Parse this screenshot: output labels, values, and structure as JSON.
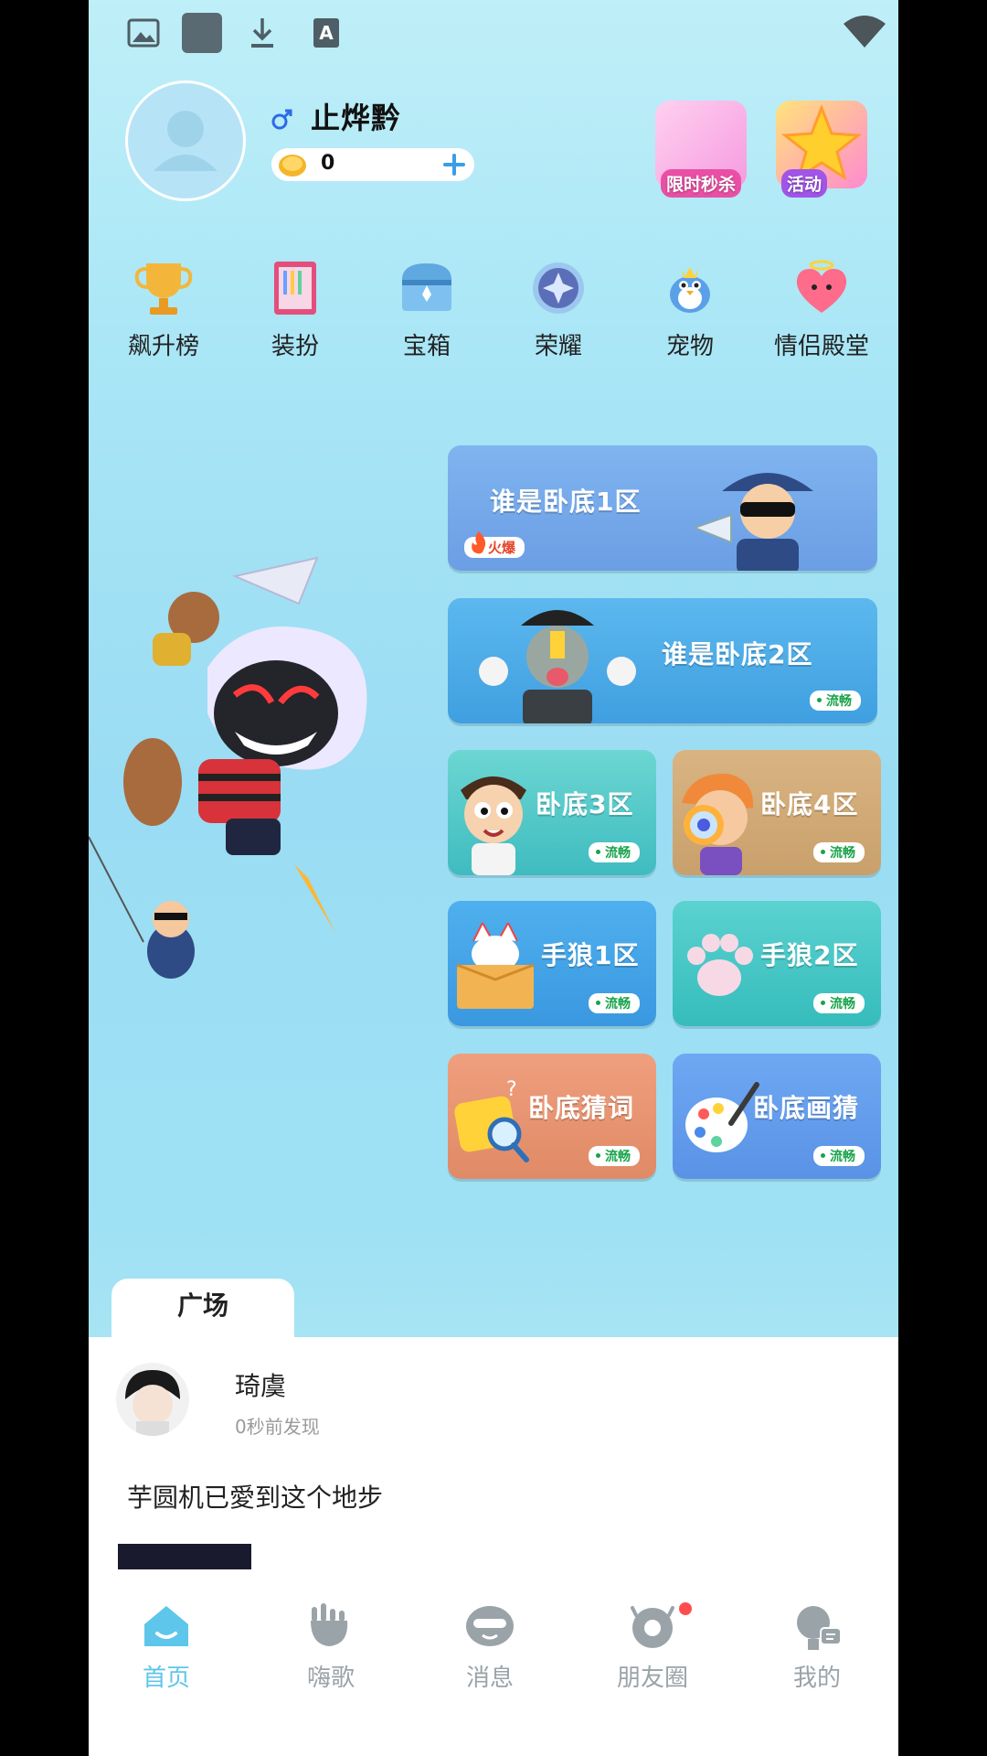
{
  "profile": {
    "username": "止烨黔",
    "coins": "0"
  },
  "promos": [
    {
      "label": "限时秒杀",
      "icon": "gift-box-icon",
      "color": "#e94fa5"
    },
    {
      "label": "活动",
      "icon": "star-icon",
      "color": "#a154e8"
    }
  ],
  "top_icons": [
    {
      "label": "飙升榜",
      "icon": "trophy-icon"
    },
    {
      "label": "装扮",
      "icon": "wardrobe-icon"
    },
    {
      "label": "宝箱",
      "icon": "treasure-chest-icon"
    },
    {
      "label": "荣耀",
      "icon": "honor-emblem-icon"
    },
    {
      "label": "宠物",
      "icon": "pet-bird-icon"
    },
    {
      "label": "情侣殿堂",
      "icon": "heart-icon"
    }
  ],
  "cards": [
    {
      "title": "谁是卧底1区",
      "badge": "火爆"
    },
    {
      "title": "谁是卧底2区",
      "badge": "流畅"
    },
    {
      "title": "卧底3区",
      "badge": "流畅"
    },
    {
      "title": "卧底4区",
      "badge": "流畅"
    },
    {
      "title": "手狼1区",
      "badge": "流畅"
    },
    {
      "title": "手狼2区",
      "badge": "流畅"
    },
    {
      "title": "卧底猜词",
      "badge": "流畅"
    },
    {
      "title": "卧底画猜",
      "badge": "流畅"
    }
  ],
  "square": {
    "tab": "广场",
    "post": {
      "name": "琦虞",
      "time": "0秒前发现",
      "text": "芋圆机已愛到这个地步"
    }
  },
  "nav": [
    {
      "label": "首页",
      "icon": "home-icon",
      "active": true
    },
    {
      "label": "嗨歌",
      "icon": "music-hand-icon"
    },
    {
      "label": "消息",
      "icon": "message-face-icon"
    },
    {
      "label": "朋友圈",
      "icon": "camera-moments-icon"
    },
    {
      "label": "我的",
      "icon": "profile-icon"
    }
  ],
  "colors": {
    "accent": "#5ec6ea",
    "badge_green": "#18a34a",
    "hot_red": "#e5462b"
  }
}
